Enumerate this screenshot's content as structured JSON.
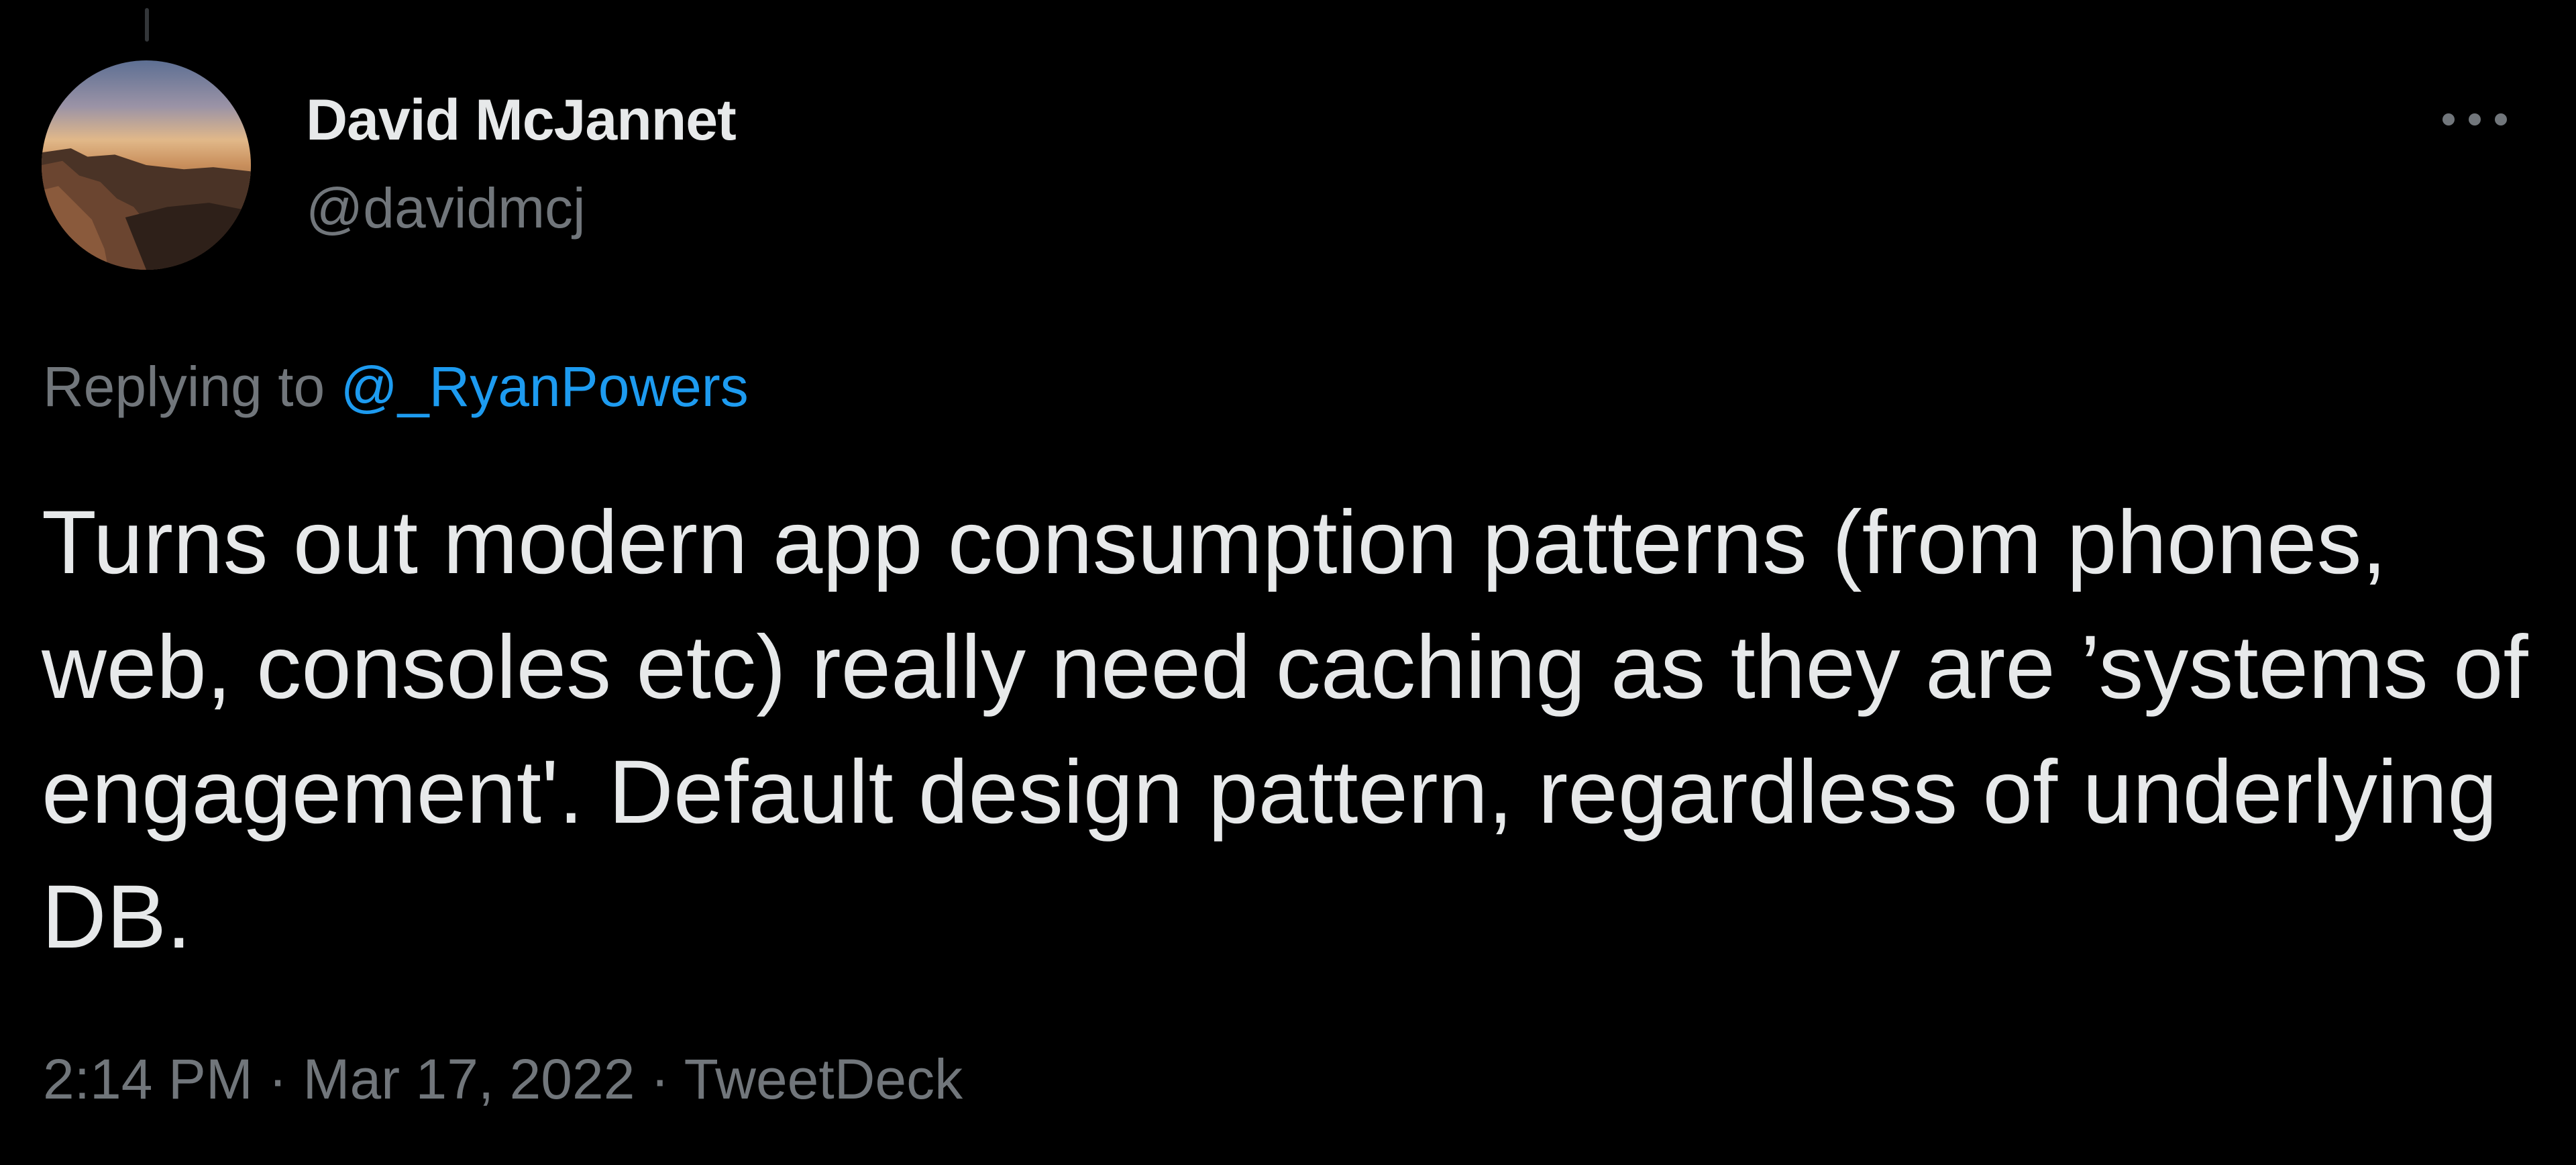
{
  "tweet": {
    "author": {
      "display_name": "David McJannet",
      "handle": "@davidmcj"
    },
    "reply": {
      "prefix": "Replying to ",
      "mention": "@_RyanPowers"
    },
    "text": "Turns out modern app consumption patterns (from phones, web, consoles etc) really need caching as they are ’systems of engagement'. Default design pattern, regardless of underlying DB.",
    "meta": {
      "time": "2:14 PM",
      "separator": " · ",
      "date": "Mar 17, 2022",
      "source": "TweetDeck"
    }
  },
  "icons": {
    "more": "more-horizontal-icon",
    "avatar": "profile-photo"
  },
  "colors": {
    "background": "#000000",
    "primary_text": "#e7e9ea",
    "secondary_text": "#71767b",
    "link": "#1d9bf0"
  }
}
